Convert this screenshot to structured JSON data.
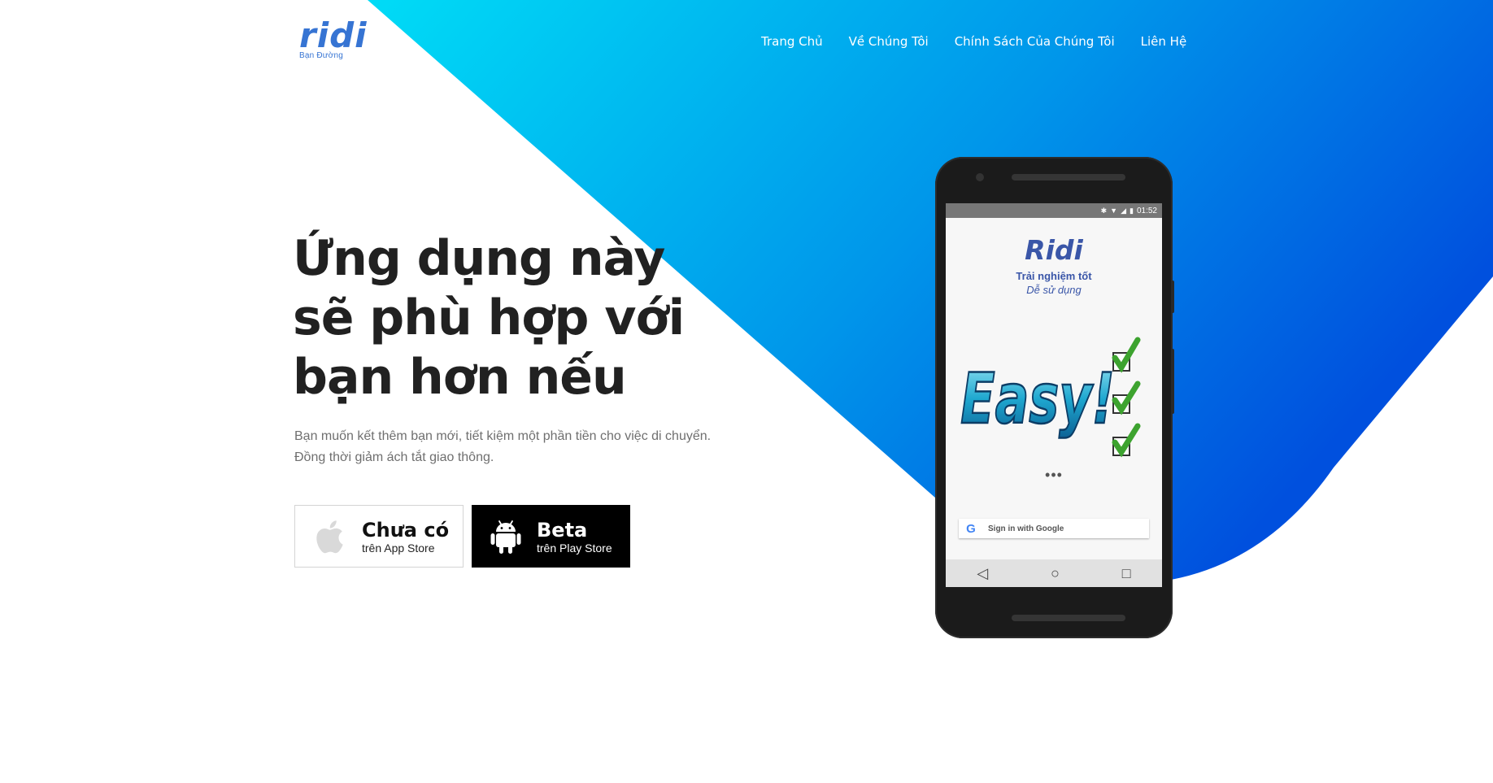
{
  "brand": {
    "logo_text": "ridi",
    "logo_subtitle": "Bạn Đường",
    "primary_color": "#3674d3",
    "gradient": [
      "#00d8f5",
      "#0057e0"
    ]
  },
  "nav": {
    "items": [
      {
        "label": "Trang Chủ"
      },
      {
        "label": "Về Chúng Tôi"
      },
      {
        "label": "Chính Sách Của Chúng Tôi"
      },
      {
        "label": "Liên Hệ"
      }
    ]
  },
  "hero": {
    "title_lines": [
      "Ứng dụng này",
      "sẽ phù hợp với",
      "bạn hơn nếu"
    ],
    "description_lines": [
      "Bạn muốn kết thêm bạn mới, tiết kiệm một phần tiền cho việc di chuyển.",
      "Đồng thời giảm ách tắt giao thông."
    ]
  },
  "store_buttons": {
    "appstore": {
      "main": "Chưa có",
      "sub": "trên App Store",
      "icon": "apple-icon"
    },
    "playstore": {
      "main": "Beta",
      "sub": "trên Play Store",
      "icon": "android-icon"
    }
  },
  "phone": {
    "status_time": "01:52",
    "app_name": "Ridi",
    "tagline_1": "Trải nghiệm tốt",
    "tagline_2": "Dễ sử dụng",
    "art_text": "Easy!",
    "loading": "•••",
    "google_button": "Sign in with Google",
    "google_glyph": "G"
  }
}
